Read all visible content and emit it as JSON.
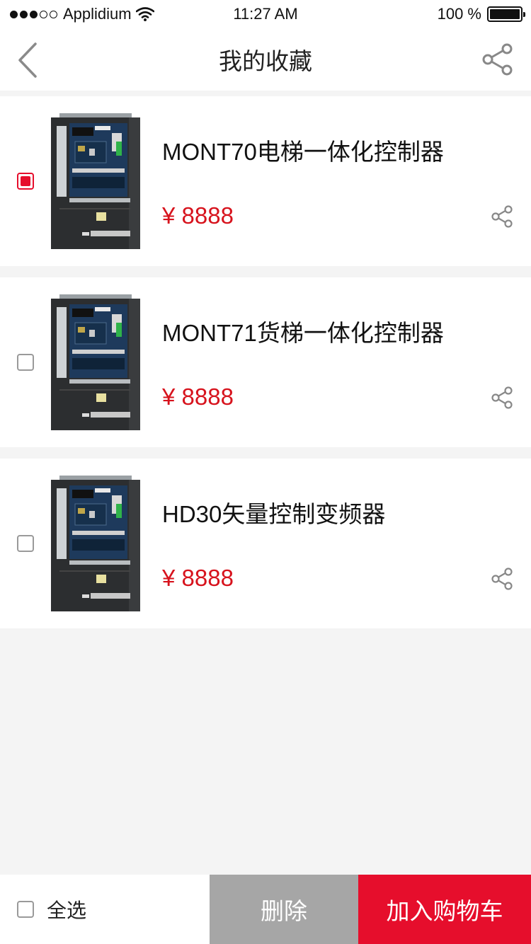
{
  "status_bar": {
    "carrier": "Applidium",
    "time": "11:27 AM",
    "battery_text": "100 %",
    "battery_level": 1.0,
    "signal_filled": 3,
    "signal_total": 5
  },
  "nav": {
    "title": "我的收藏",
    "back_icon": "chevron-left-icon",
    "share_icon": "share-icon"
  },
  "favorites": [
    {
      "name": "MONT70电梯一体化控制器",
      "price": "¥ 8888",
      "checked": true
    },
    {
      "name": "MONT71货梯一体化控制器",
      "price": "¥ 8888",
      "checked": false
    },
    {
      "name": "HD30矢量控制变频器",
      "price": "¥ 8888",
      "checked": false
    }
  ],
  "bottom_bar": {
    "select_all_label": "全选",
    "delete_label": "删除",
    "add_to_cart_label": "加入购物车"
  },
  "colors": {
    "accent": "#e60e2c",
    "price": "#d7131d",
    "delete_bg": "#a6a6a6",
    "page_bg": "#f4f4f4"
  }
}
